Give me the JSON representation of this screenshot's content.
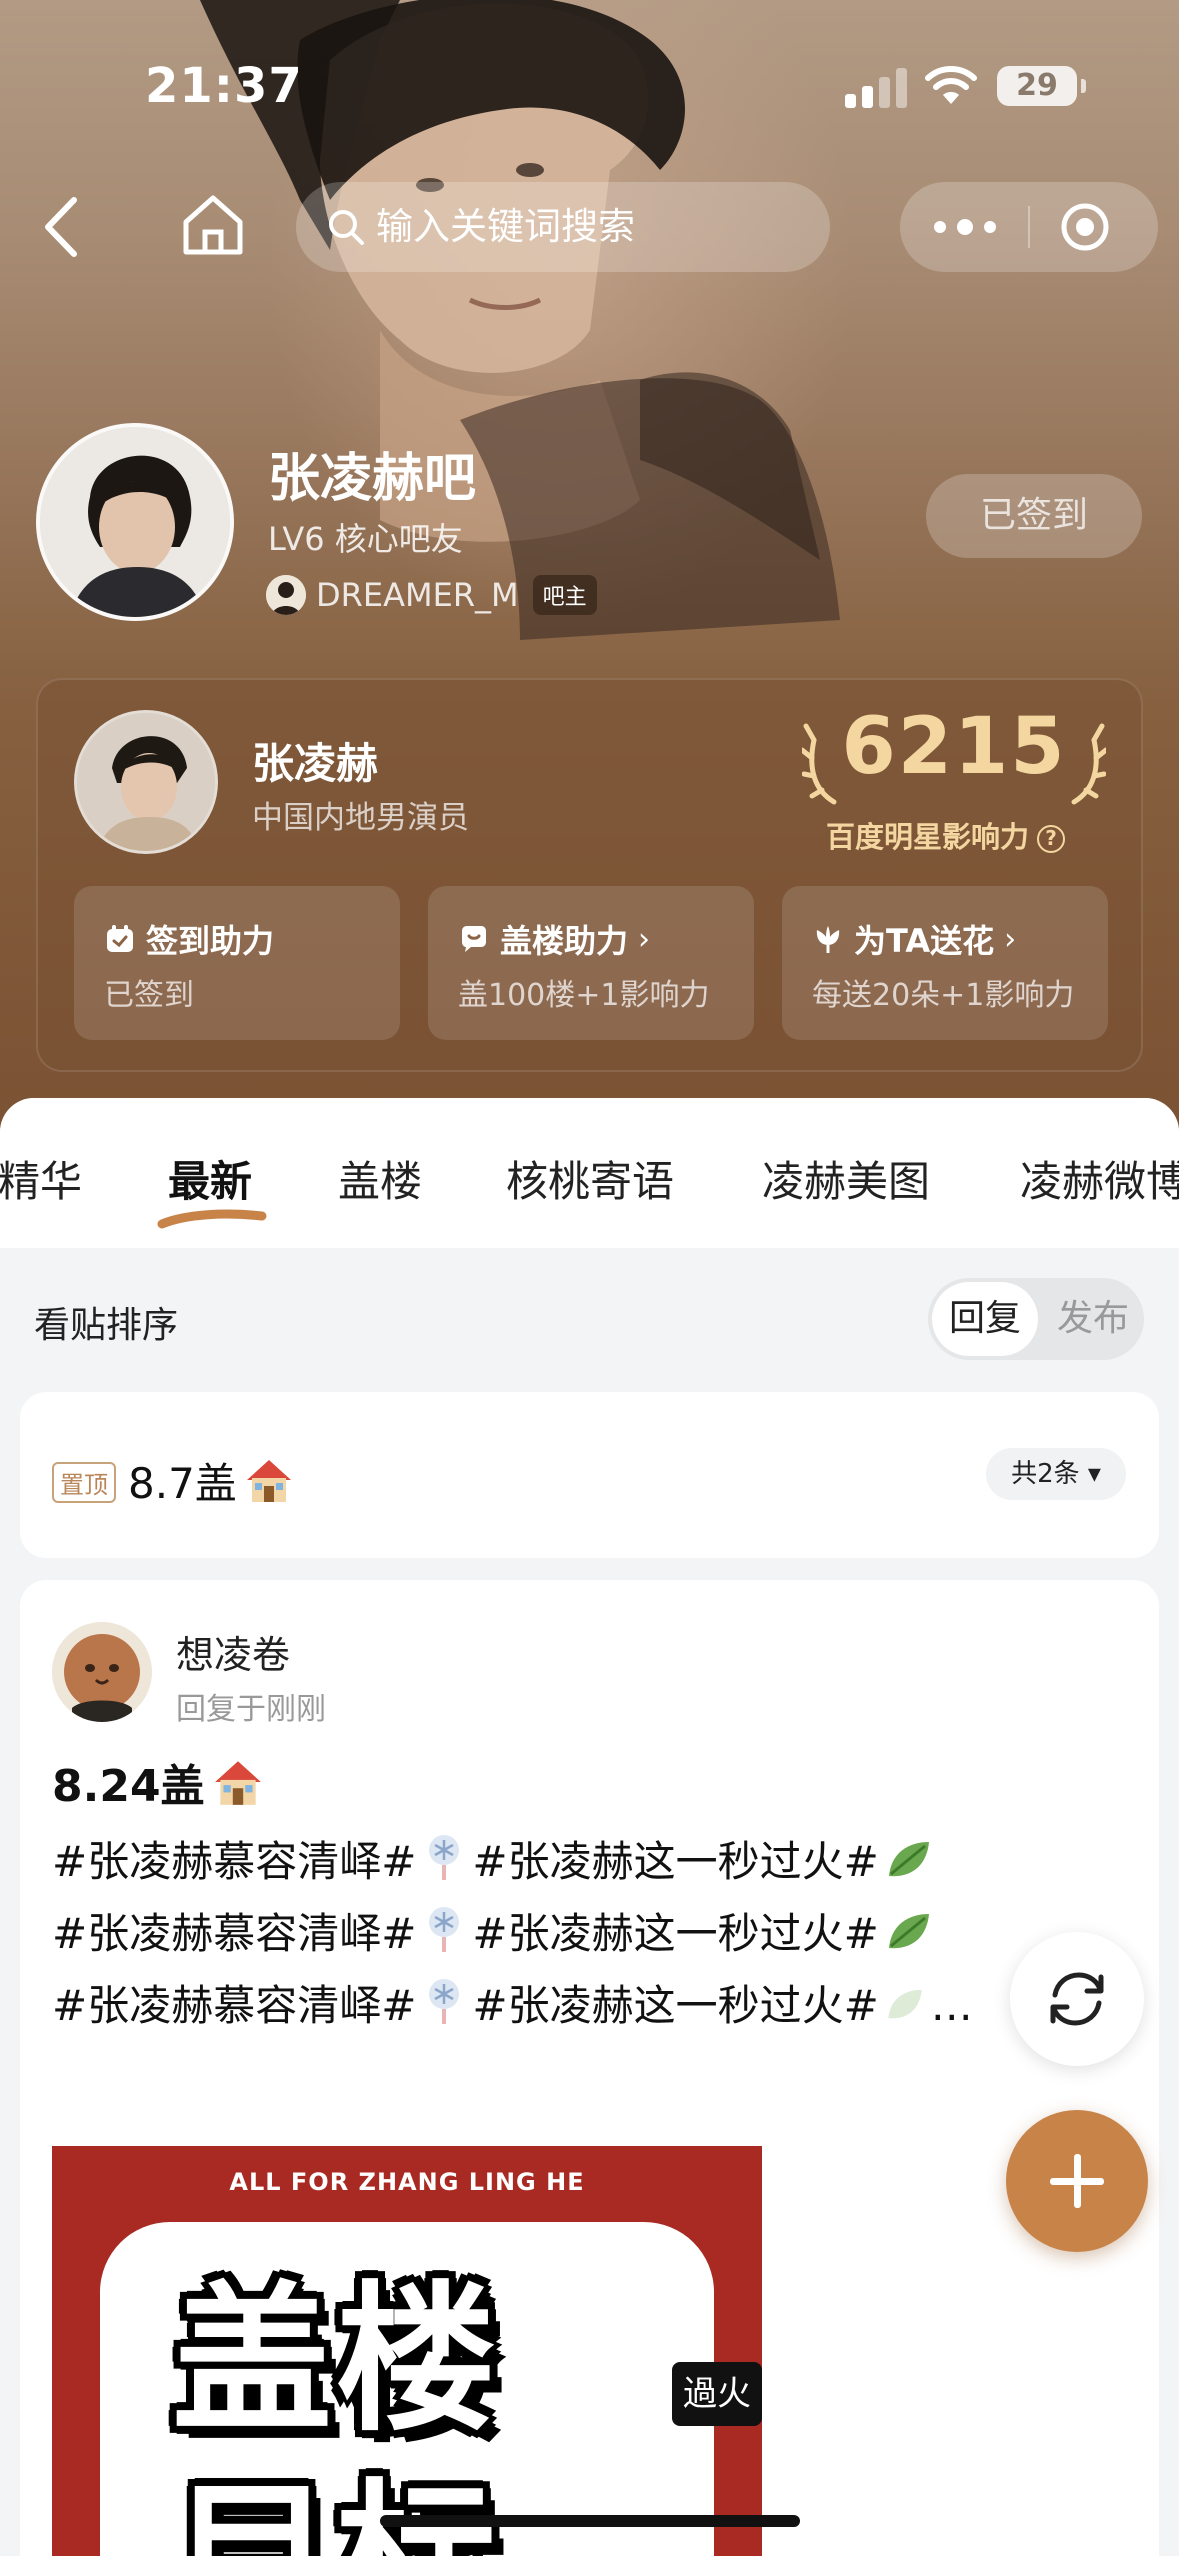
{
  "status_bar": {
    "time": "21:37",
    "battery": "29"
  },
  "nav": {
    "search_placeholder": "输入关键词搜索"
  },
  "forum": {
    "name": "张凌赫吧",
    "level": "LV6 核心吧友",
    "owner_name": "DREAMER_M",
    "owner_badge": "吧主",
    "signin_label": "已签到"
  },
  "star": {
    "name": "张凌赫",
    "description": "中国内地男演员",
    "influence_score": "6215",
    "influence_label": "百度明星影响力",
    "help_glyph": "?",
    "boosts": [
      {
        "title": "签到助力",
        "subtitle": "已签到",
        "icon": "calendar-check-icon"
      },
      {
        "title": "盖楼助力",
        "subtitle": "盖100楼+1影响力",
        "icon": "chat-bubble-icon"
      },
      {
        "title": "为TA送花",
        "subtitle": "每送20朵+1影响力",
        "icon": "flower-icon"
      }
    ]
  },
  "tabs": [
    "精华",
    "最新",
    "盖楼",
    "核桃寄语",
    "凌赫美图",
    "凌赫微博"
  ],
  "active_tab": "最新",
  "sort": {
    "label": "看贴排序",
    "option_reply": "回复",
    "option_publish": "发布",
    "selected": "回复"
  },
  "pinned_post": {
    "tag": "置顶",
    "title": "8.7盖",
    "emoji": "house-icon",
    "count_label": "共2条"
  },
  "post": {
    "username": "想凌卷",
    "time": "回复于刚刚",
    "title": "8.24盖",
    "lines": [
      {
        "a": "#张凌赫慕容清峄#",
        "b": "#张凌赫这一秒过火#"
      },
      {
        "a": "#张凌赫慕容清峄#",
        "b": "#张凌赫这一秒过火#"
      },
      {
        "a": "#张凌赫慕容清峄#",
        "b": "#张凌赫这一秒过火#",
        "more": "…"
      }
    ],
    "image": {
      "top_text": "ALL FOR ZHANG LING HE",
      "line1": "盖楼",
      "line2": "目标",
      "sticker": "過火"
    }
  },
  "colors": {
    "accent": "#c88349",
    "gold": "#f4d7a0",
    "tag": "#b9865a"
  }
}
